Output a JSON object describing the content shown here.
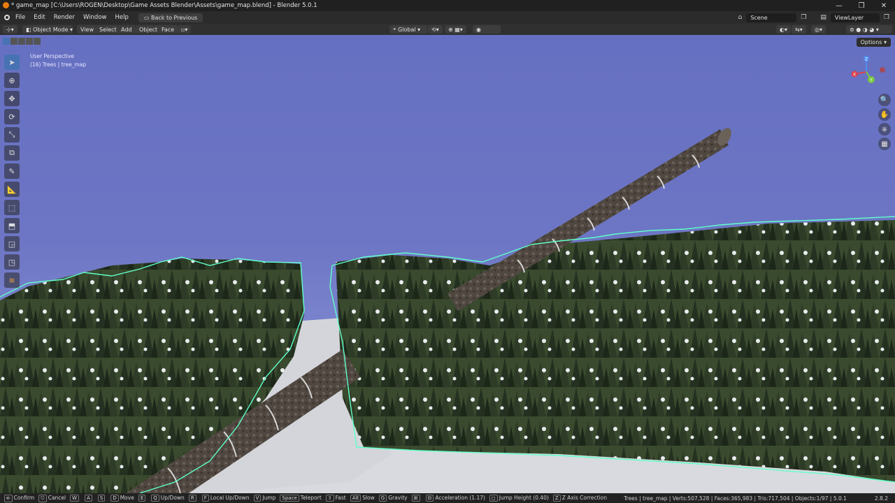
{
  "window": {
    "title": "* game_map [C:\\Users\\ROGEN\\Desktop\\Game Assets Blender\\Assets\\game_map.blend] - Blender 5.0.1",
    "controls": [
      "—",
      "❐",
      "✕"
    ]
  },
  "menubar": {
    "items": [
      "File",
      "Edit",
      "Render",
      "Window",
      "Help"
    ],
    "back_label": "Back to Previous",
    "scene": "Scene",
    "view_layer": "ViewLayer"
  },
  "header": {
    "mode": "Object Mode",
    "menus": [
      "View",
      "Select",
      "Add",
      "Object",
      "Face"
    ],
    "orientation": "Global"
  },
  "viewport": {
    "perspective": "User Perspective",
    "object_info": "(16) Trees | tree_map",
    "options_label": "Options",
    "gizmo": {
      "z": "Z",
      "y": "Y",
      "x": "X"
    },
    "colors": {
      "sky": "#6c75c4",
      "snow": "#dfe0e4",
      "tree": "#2f3a26",
      "outline": "#5fffc8",
      "log": "#5a5149"
    }
  },
  "statusbar": {
    "hints": [
      {
        "keys": [
          "⎆"
        ],
        "label": "Confirm"
      },
      {
        "keys": [
          "⎋"
        ],
        "label": "Cancel"
      },
      {
        "keys": [
          "W",
          "A",
          "S",
          "D"
        ],
        "label": "Move"
      },
      {
        "keys": [
          "E",
          "Q"
        ],
        "label": "Up/Down"
      },
      {
        "keys": [
          "R",
          "F"
        ],
        "label": "Local Up/Down"
      },
      {
        "keys": [
          "V"
        ],
        "label": "Jump"
      },
      {
        "keys": [
          "Space"
        ],
        "label": "Teleport"
      },
      {
        "keys": [
          "⇧"
        ],
        "label": "Fast"
      },
      {
        "keys": [
          "Alt"
        ],
        "label": "Slow"
      },
      {
        "keys": [
          "G"
        ],
        "label": "Gravity"
      },
      {
        "keys": [
          "⊞",
          "⊟"
        ],
        "label": "Acceleration (1.17)"
      },
      {
        "keys": [
          "◻"
        ],
        "label": "Jump Height (0.40)"
      },
      {
        "keys": [
          "Z"
        ],
        "label": "Z Axis Correction"
      }
    ],
    "stats": "Trees | tree_map | Verts:507,528 | Faces:365,983 | Tris:717,504 | Objects:1/97 | 5.0.1",
    "version": "2.8.2"
  }
}
